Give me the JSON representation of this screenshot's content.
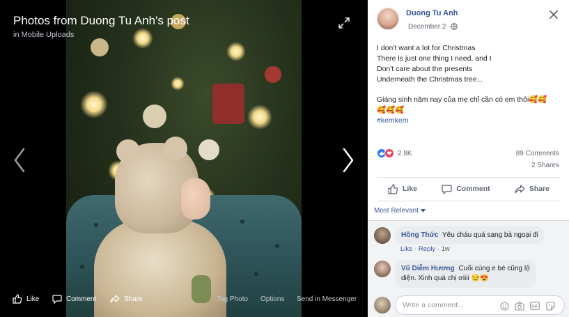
{
  "viewer": {
    "title": "Photos from Duong Tu Anh's post",
    "album": "in Mobile Uploads",
    "actions": {
      "like": "Like",
      "comment": "Comment",
      "share": "Share",
      "tag_photo": "Tag Photo",
      "options": "Options",
      "send": "Send in Messenger"
    }
  },
  "post": {
    "author": "Duong Tu Anh",
    "date": "December 2",
    "text_lines": [
      "I don't want a lot for Christmas",
      "There is just one thing I need, and I",
      "Don't care about the presents",
      "Underneath the Christmas tree..."
    ],
    "caption_line1": "Giáng sinh năm nay của mẹ chỉ cần có em thôi🥰🥰",
    "caption_line2": "🥰🥰🥰",
    "hashtag": "#kemkem",
    "reactions_count": "2.8K",
    "comments_count": "89 Comments",
    "shares_count": "2 Shares",
    "actions": {
      "like": "Like",
      "comment": "Comment",
      "share": "Share"
    },
    "sort_label": "Most Relevant"
  },
  "comments": [
    {
      "name": "Hồng Thức",
      "text": "Yêu cháu quá sang bà ngoại đi",
      "meta": {
        "like": "Like",
        "reply": "Reply",
        "age": "1w"
      }
    },
    {
      "name": "Vũ Diễm Hương",
      "text_line1": "Cuối cùng e bé cũng lộ",
      "text_line2": "diện. Xinh quá chị ơiiii 😏😍"
    }
  ],
  "composer": {
    "placeholder": "Write a comment..."
  },
  "colors": {
    "link": "#385898",
    "like_blue": "#2078f4",
    "love_red": "#f33e58",
    "stage_bg": "#000000"
  }
}
